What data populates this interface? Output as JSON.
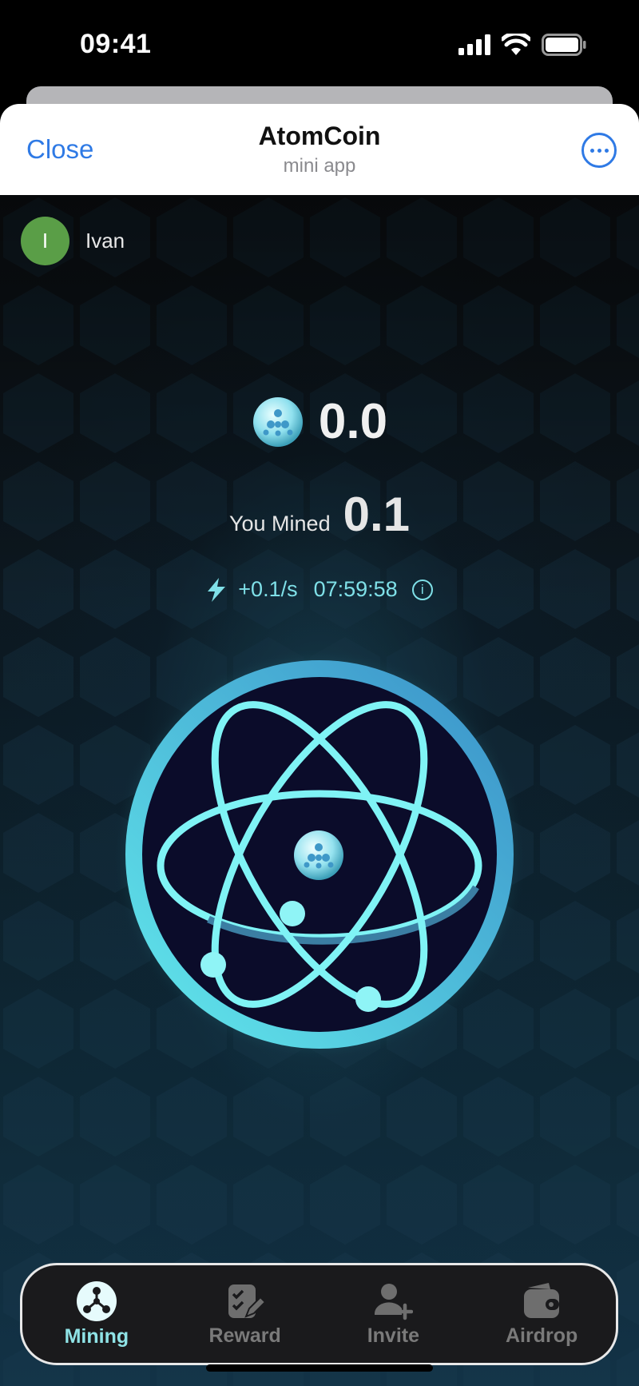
{
  "status_bar": {
    "time": "09:41"
  },
  "header": {
    "close_label": "Close",
    "title": "AtomCoin",
    "subtitle": "mini app"
  },
  "user": {
    "initial": "I",
    "name": "Ivan",
    "avatar_color": "#5a9e47"
  },
  "stats": {
    "balance": "0.0",
    "mined_label": "You Mined",
    "mined_value": "0.1",
    "rate": "+0.1/s",
    "timer": "07:59:58"
  },
  "nav": {
    "items": [
      {
        "label": "Mining",
        "icon": "atom-network-icon",
        "active": true
      },
      {
        "label": "Reward",
        "icon": "checklist-edit-icon",
        "active": false
      },
      {
        "label": "Invite",
        "icon": "user-plus-icon",
        "active": false
      },
      {
        "label": "Airdrop",
        "icon": "wallet-icon",
        "active": false
      }
    ]
  },
  "colors": {
    "accent_blue": "#2f7ae5",
    "accent_cyan": "#7fe0e8",
    "orbit": "#7ff3f5",
    "core_dark": "#0b0c2a"
  }
}
